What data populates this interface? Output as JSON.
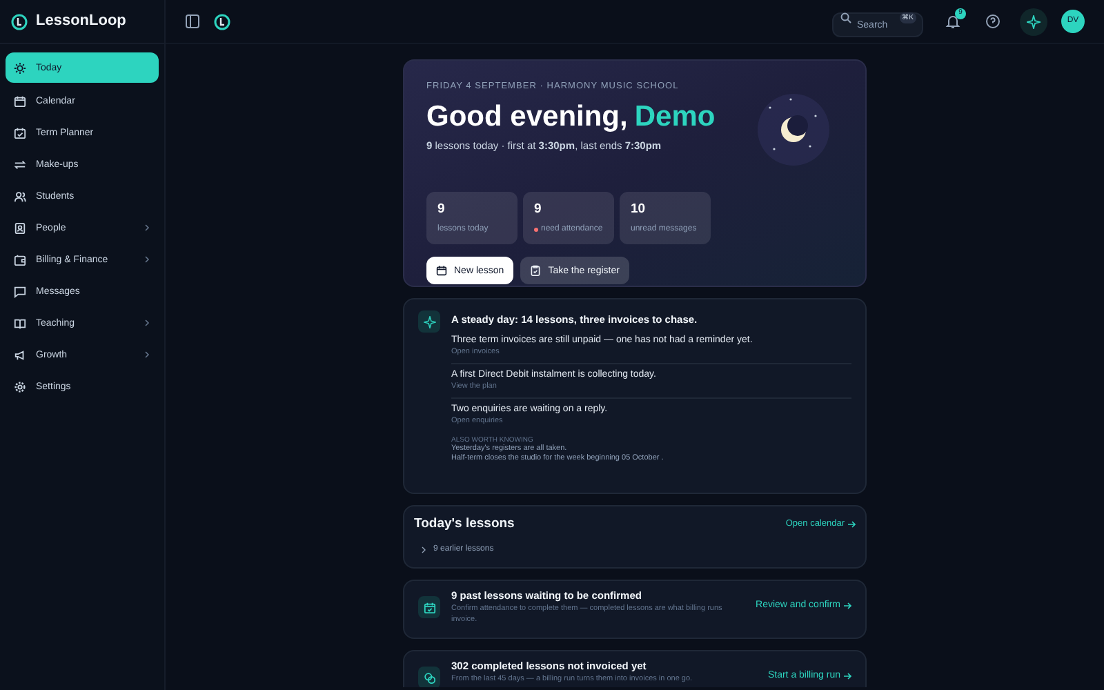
{
  "brand": {
    "name": "LessonLoop"
  },
  "sidebar": {
    "items": [
      {
        "label": "Today",
        "selected": true,
        "has_submenu": false
      },
      {
        "label": "Calendar",
        "selected": false,
        "has_submenu": false
      },
      {
        "label": "Term Planner",
        "selected": false,
        "has_submenu": false
      },
      {
        "label": "Make-ups",
        "selected": false,
        "has_submenu": false
      },
      {
        "label": "Students",
        "selected": false,
        "has_submenu": false
      },
      {
        "label": "People",
        "selected": false,
        "has_submenu": true
      },
      {
        "label": "Billing & Finance",
        "selected": false,
        "has_submenu": true
      },
      {
        "label": "Messages",
        "selected": false,
        "has_submenu": false
      },
      {
        "label": "Teaching",
        "selected": false,
        "has_submenu": true
      },
      {
        "label": "Growth",
        "selected": false,
        "has_submenu": true
      },
      {
        "label": "Settings",
        "selected": false,
        "has_submenu": false
      }
    ]
  },
  "topbar": {
    "search": {
      "placeholder": "Search",
      "shortcut": "⌘K"
    },
    "notification_count": "9",
    "avatar": "DV"
  },
  "hero": {
    "eyebrow": "FRIDAY 4 SEPTEMBER · HARMONY MUSIC SCHOOL",
    "greeting": "Good evening,",
    "name": "Demo",
    "summary": "**9** lessons today · first at **3:30pm**, last ends **7:30pm**",
    "stats": [
      {
        "value": "9",
        "label": "lessons today",
        "alert": false
      },
      {
        "value": "9",
        "label": "need attendance",
        "alert": true
      },
      {
        "value": "10",
        "label": "unread messages",
        "alert": false
      }
    ],
    "buttons": [
      {
        "label": "New lesson",
        "primary": true
      },
      {
        "label": "Take the register",
        "primary": false
      }
    ]
  },
  "insights": {
    "headline": "A steady day: 14 lessons, three invoices to chase.",
    "items": [
      {
        "text": "Three term invoices are still unpaid — one has not had a reminder yet.",
        "link": "Open invoices"
      },
      {
        "text": "A first Direct Debit instalment is collecting today.",
        "link": "View the plan"
      },
      {
        "text": "Two enquiries are waiting on a reply.",
        "link": "Open enquiries"
      }
    ],
    "also_heading": "ALSO WORTH KNOWING",
    "also": [
      "Yesterday's registers are all taken.",
      "Half-term closes the studio for the week beginning 05 October ."
    ]
  },
  "todays_lessons": {
    "title": "Today's lessons",
    "link": "Open calendar",
    "earlier": "9 earlier lessons",
    "expanded": false
  },
  "actions": [
    {
      "kind": "calendar",
      "title": "9 past lessons waiting to be confirmed",
      "text": "Confirm attendance to complete them — completed lessons are what billing runs invoice.",
      "link": "Review and confirm"
    },
    {
      "kind": "coins",
      "title": "302 completed lessons not invoiced yet",
      "text": "From the last 45 days — a billing run turns them into invoices in one go.",
      "link": "Start a billing run"
    }
  ]
}
